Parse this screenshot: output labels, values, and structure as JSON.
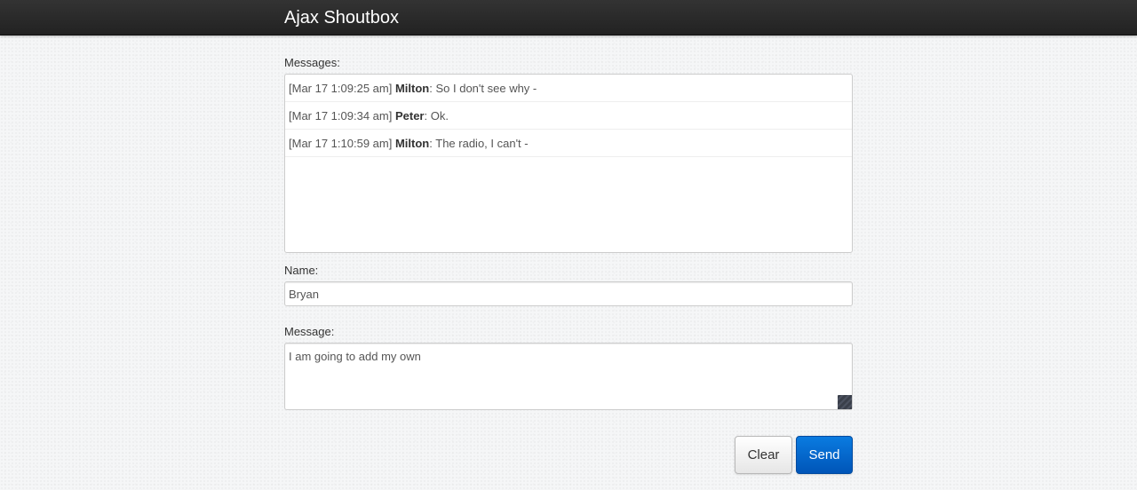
{
  "navbar": {
    "brand": "Ajax Shoutbox"
  },
  "messages": {
    "label": "Messages:",
    "items": [
      {
        "timestamp": "[Mar 17 1:09:25 am]",
        "author": "Milton",
        "separator": ":",
        "text": "So I don't see why -"
      },
      {
        "timestamp": "[Mar 17 1:09:34 am]",
        "author": "Peter",
        "separator": ":",
        "text": "Ok."
      },
      {
        "timestamp": "[Mar 17 1:10:59 am]",
        "author": "Milton",
        "separator": ":",
        "text": "The radio, I can't -"
      }
    ]
  },
  "form": {
    "name_label": "Name:",
    "name_value": "Bryan",
    "message_label": "Message:",
    "message_value": "I am going to add my own"
  },
  "buttons": {
    "clear": "Clear",
    "send": "Send"
  },
  "colors": {
    "navbar_bg": "#222222",
    "send_button": "#0066cc",
    "clear_button": "#e6e6e6"
  }
}
